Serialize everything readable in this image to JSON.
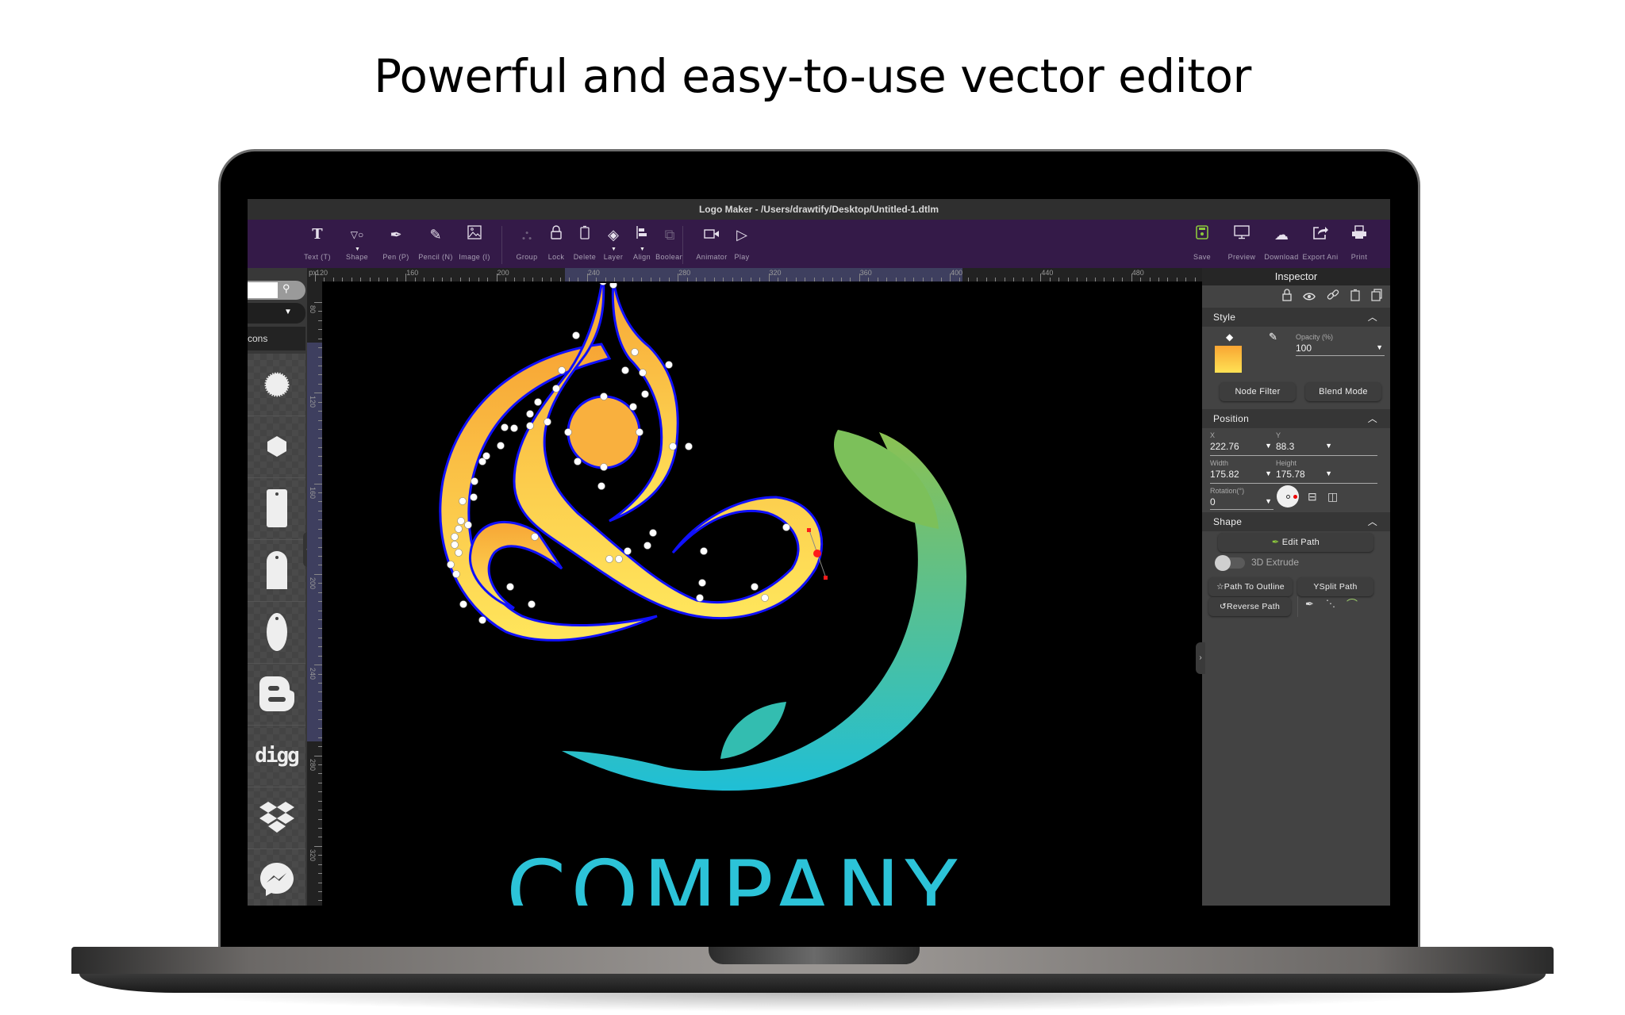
{
  "headline": "Powerful and easy-to-use vector editor",
  "window": {
    "title": "Logo Maker - /Users/drawtify/Desktop/Untitled-1.dtlm"
  },
  "toolbar": {
    "left_tools": [
      {
        "label": "Text (T)",
        "icon": "text-tool-icon",
        "glyph": "T"
      },
      {
        "label": "Shape",
        "icon": "shape-tool-icon",
        "glyph": "▽○"
      },
      {
        "label": "Pen (P)",
        "icon": "pen-tool-icon",
        "glyph": "✒"
      },
      {
        "label": "Pencil (N)",
        "icon": "pencil-tool-icon",
        "glyph": "✎"
      },
      {
        "label": "Image (I)",
        "icon": "image-tool-icon",
        "glyph": "🖼"
      }
    ],
    "object_tools": [
      {
        "label": "Group",
        "icon": "group-icon",
        "glyph": "⛬"
      },
      {
        "label": "Lock",
        "icon": "lock-icon",
        "glyph": "🔒"
      },
      {
        "label": "Delete",
        "icon": "delete-icon",
        "glyph": "▯"
      },
      {
        "label": "Layer",
        "icon": "layer-icon",
        "glyph": "◈"
      },
      {
        "label": "Align",
        "icon": "align-icon",
        "glyph": "⊫"
      },
      {
        "label": "Boolean",
        "icon": "boolean-icon",
        "glyph": "⧉"
      }
    ],
    "anim_tools": [
      {
        "label": "Animator",
        "icon": "animator-camera-icon",
        "glyph": "▭◂"
      },
      {
        "label": "Play",
        "icon": "play-icon",
        "glyph": "▷"
      }
    ],
    "right_tools": [
      {
        "label": "Save",
        "icon": "save-icon",
        "glyph": "▣"
      },
      {
        "label": "Preview",
        "icon": "preview-monitor-icon",
        "glyph": "🖵"
      },
      {
        "label": "Download",
        "icon": "download-cloud-icon",
        "glyph": "☁"
      },
      {
        "label": "Export Ani",
        "icon": "export-share-icon",
        "glyph": "⇪"
      },
      {
        "label": "Print",
        "icon": "print-icon",
        "glyph": "⎙"
      }
    ]
  },
  "left_panel": {
    "search_placeholder": "",
    "category": "Icons",
    "category_visible": "cons",
    "items": [
      "sticker-circle",
      "hexagon",
      "tag-rectangle",
      "tag-arch",
      "tag-oval",
      "blogger",
      "digg",
      "dropbox",
      "messenger"
    ],
    "digg_label": "digg"
  },
  "rulers": {
    "unit": "px",
    "h_ticks": [
      "120",
      "160",
      "200",
      "240",
      "280",
      "320",
      "360",
      "400",
      "440",
      "480"
    ],
    "v_ticks": [
      "80",
      "120",
      "160",
      "200",
      "240",
      "280",
      "320"
    ]
  },
  "canvas": {
    "logo_text_partial": "COMPANY",
    "colors": {
      "orange": "#f7a535",
      "yellow": "#ffe25a",
      "green": "#8cc152",
      "teal": "#1fbfd6",
      "path_outline": "#1010ff",
      "selected_node": "#ff1a1a"
    }
  },
  "inspector": {
    "title": "Inspector",
    "style": {
      "header": "Style",
      "opacity_label": "Opacity (%)",
      "opacity_value": "100",
      "fill_color_top": "#f9a533",
      "fill_color_bottom": "#ffe254",
      "node_filter": "Node Filter",
      "blend_mode": "Blend Mode"
    },
    "position": {
      "header": "Position",
      "x_label": "X",
      "x_value": "222.76",
      "y_label": "Y",
      "y_value": "88.3",
      "width_label": "Width",
      "width_value": "175.82",
      "height_label": "Height",
      "height_value": "175.78",
      "rotation_label": "Rotation(°)",
      "rotation_value": "0"
    },
    "shape": {
      "header": "Shape",
      "edit_path": "Edit Path",
      "extrude_label": "3D Extrude",
      "extrude_on": false,
      "path_to_outline": "Path To Outline",
      "split_path": "Split Path",
      "reverse_path": "Reverse Path"
    }
  }
}
